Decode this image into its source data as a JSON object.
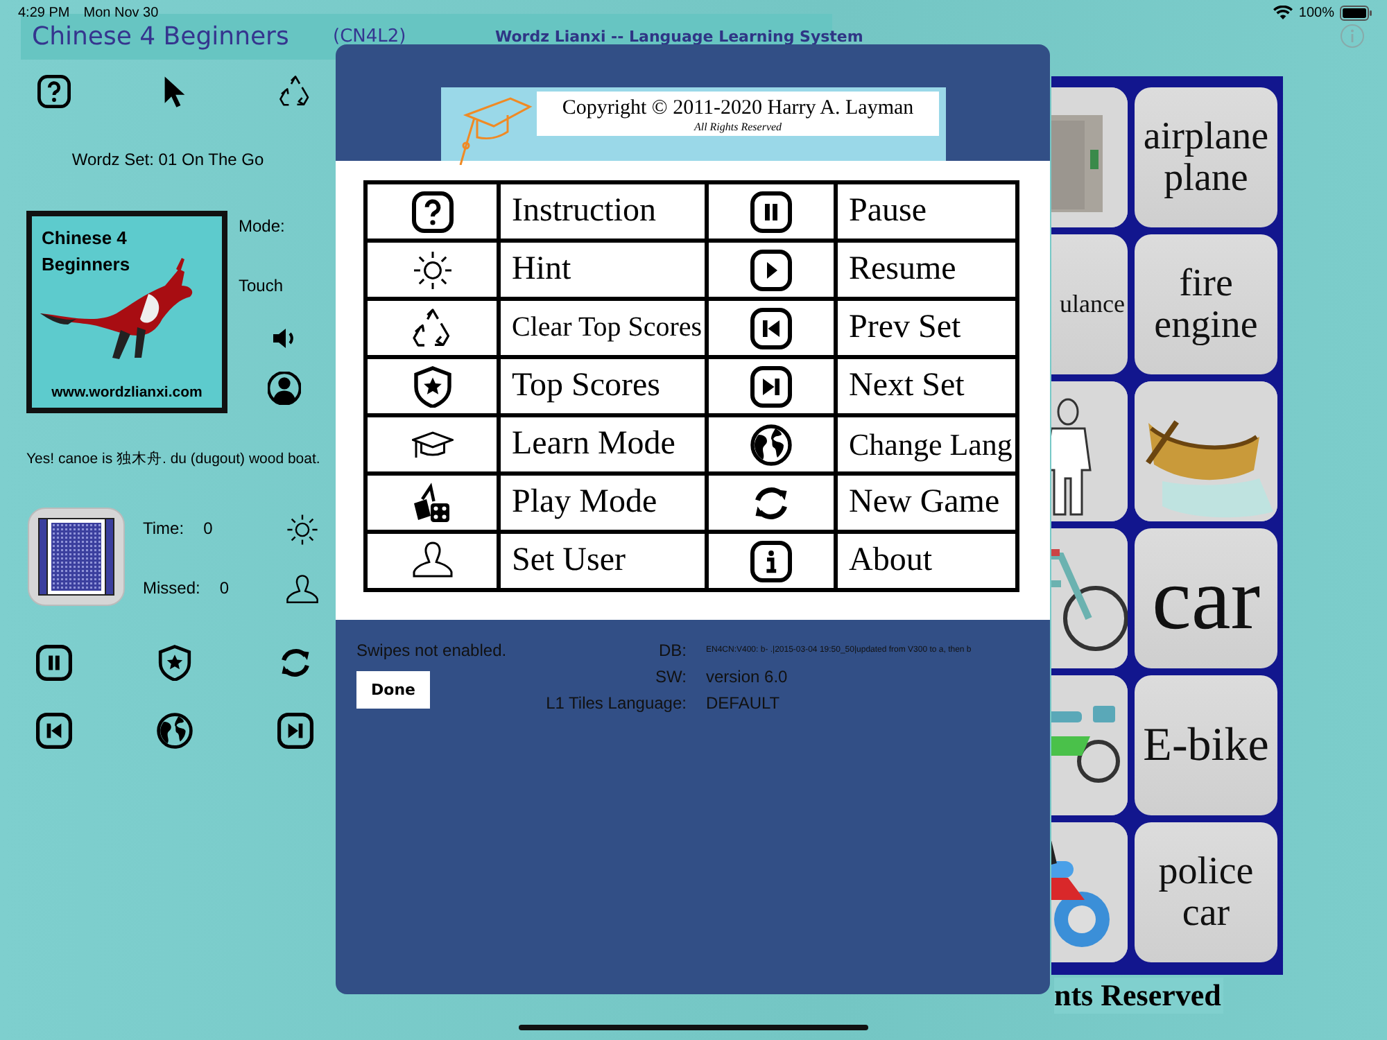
{
  "status_bar": {
    "time": "4:29 PM",
    "date": "Mon Nov 30",
    "battery": "100%"
  },
  "header": {
    "title": "Chinese 4 Beginners",
    "code": "(CN4L2)",
    "tagline": "Wordz Lianxi -- Language Learning System"
  },
  "side_panel": {
    "toolbar": [
      {
        "kind": "help"
      },
      {
        "kind": "pointer"
      },
      {
        "kind": "recycle"
      }
    ],
    "set_label": "Wordz Set: 01 On The Go",
    "logo": {
      "line_1": "Chinese 4",
      "line_2": "Beginners",
      "url": "www.wordzlianxi.com"
    },
    "mode_label": "Mode:",
    "mode_value": "Touch",
    "feedback": "Yes! canoe is 独木舟. du (dugout) wood boat.",
    "stats": [
      {
        "label": "Time:",
        "value": "0",
        "kind": "hint"
      },
      {
        "label": "Missed:",
        "value": "0",
        "kind": "user"
      }
    ],
    "controls": [
      {
        "kind": "pause"
      },
      {
        "kind": "shield"
      },
      {
        "kind": "refresh"
      },
      {
        "kind": "prev"
      },
      {
        "kind": "globe"
      },
      {
        "kind": "next"
      }
    ]
  },
  "tiles": [
    {
      "kind": "picture"
    },
    {
      "kind": "word",
      "text": "airplane plane"
    },
    {
      "kind": "word",
      "text": "ulance"
    },
    {
      "kind": "word",
      "text": "fire engine"
    },
    {
      "kind": "picture"
    },
    {
      "kind": "picture"
    },
    {
      "kind": "picture"
    },
    {
      "kind": "word",
      "text": "car"
    },
    {
      "kind": "picture"
    },
    {
      "kind": "word",
      "text": "E-bike"
    },
    {
      "kind": "picture"
    },
    {
      "kind": "word",
      "text": "police car"
    }
  ],
  "footer": "nts Reserved",
  "dialog": {
    "copyright": "Copyright © 2011-2020 Harry A. Layman",
    "rights": "All Rights Reserved",
    "commands": [
      {
        "kind": "help",
        "label": "Instruction"
      },
      {
        "kind": "pause",
        "label": "Pause"
      },
      {
        "kind": "sun",
        "label": "Hint"
      },
      {
        "kind": "play",
        "label": "Resume"
      },
      {
        "kind": "recycle",
        "label": "Clear Top Scores"
      },
      {
        "kind": "prev",
        "label": "Prev Set"
      },
      {
        "kind": "shield",
        "label": "Top Scores"
      },
      {
        "kind": "next",
        "label": "Next Set"
      },
      {
        "kind": "cap",
        "label": "Learn Mode"
      },
      {
        "kind": "globe",
        "label": "Change Lang"
      },
      {
        "kind": "dice",
        "label": "Play Mode"
      },
      {
        "kind": "refresh",
        "label": "New Game"
      },
      {
        "kind": "person",
        "label": "Set User"
      },
      {
        "kind": "info",
        "label": "About"
      }
    ],
    "message": "Swipes not enabled.",
    "done": "Done",
    "info": [
      {
        "label": "DB:",
        "value": "EN4CN:V400: b- .|2015-03-04 19:50_50|updated from V300 to a, then b",
        "kind": "small"
      },
      {
        "label": "SW:",
        "value": "version 6.0",
        "kind": "normal"
      },
      {
        "label": "L1 Tiles Language:",
        "value": "DEFAULT",
        "kind": "normal"
      }
    ]
  }
}
